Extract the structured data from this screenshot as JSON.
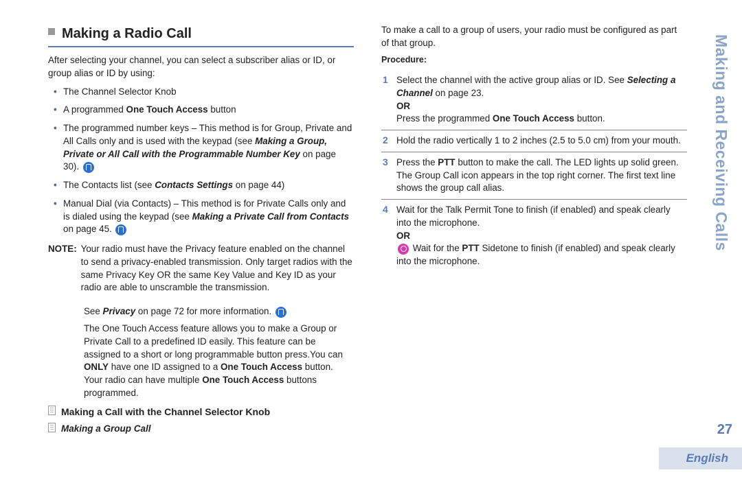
{
  "sideTitle": "Making and Receiving Calls",
  "pageNumber": "27",
  "language": "English",
  "heading": "Making a Radio Call",
  "intro": "After selecting your channel, you can select a subscriber alias or ID, or group alias or ID by using:",
  "bullets": {
    "b1": "The Channel Selector Knob",
    "b2a": "A programmed ",
    "b2b": "One Touch Access",
    "b2c": " button",
    "b3a": "The programmed number keys – This method is for Group, Private and All Calls only and is used with the keypad (see ",
    "b3b": "Making a Group, Private or All Call with the Programmable Number Key",
    "b3c": " on page 30).  ",
    "b4a": "The Contacts list (see ",
    "b4b": "Contacts Settings",
    "b4c": " on page 44)",
    "b5a": "Manual Dial (via Contacts) – This method is for Private Calls only and is dialed using the keypad (see ",
    "b5b": "Making a Private Call from Contacts",
    "b5c": " on page 45.  "
  },
  "note": {
    "label": "NOTE:",
    "body1": "Your radio must have the Privacy feature enabled on the channel to send a privacy-enabled transmission. Only target radios with the same Privacy Key OR the same Key Value and Key ID as your radio are able to unscramble the transmission.",
    "body2a": "See ",
    "body2b": "Privacy",
    "body2c": " on page 72 for more information.  ",
    "body3a": "The One Touch Access feature allows you to make a Group or Private Call to a predefined ID easily. This feature can be assigned to a short or long programmable button press.You can ",
    "body3b": "ONLY",
    "body3c": " have one ID assigned to a ",
    "body3d": "One Touch Access",
    "body3e": " button. Your radio can have multiple ",
    "body3f": "One Touch Access",
    "body3g": " buttons programmed."
  },
  "h2": "Making a Call with the Channel Selector Knob",
  "h3": "Making a Group Call",
  "h3intro": "To make a call to a group of users, your radio must be configured as part of that group.",
  "procLabel": "Procedure:",
  "steps": {
    "s1a": "Select the channel with the active group alias or ID. See ",
    "s1b": "Selecting a Channel",
    "s1c": " on page 23.",
    "s1or": "OR",
    "s1d": "Press the programmed ",
    "s1e": "One Touch Access",
    "s1f": " button.",
    "s2": "Hold the radio vertically 1 to 2 inches (2.5 to 5.0 cm) from your mouth.",
    "s3a": "Press the ",
    "s3b": "PTT",
    "s3c": " button to make the call. The LED lights up solid green. The Group Call icon appears in the top right corner. The first text line shows the group call alias.",
    "s4a": "Wait for the Talk Permit Tone to finish (if enabled) and speak clearly into the microphone.",
    "s4or": "OR",
    "s4b": " Wait for the ",
    "s4c": "PTT",
    "s4d": " Sidetone to finish (if enabled) and speak clearly into the microphone."
  }
}
